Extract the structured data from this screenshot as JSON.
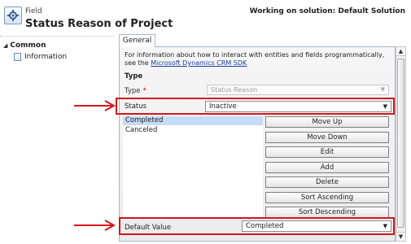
{
  "header": {
    "subtitle": "Field",
    "title": "Status Reason of Project",
    "solution": "Working on solution: Default Solution",
    "icon": "field-settings-icon"
  },
  "nav": {
    "group": "Common",
    "items": [
      {
        "label": "Information",
        "icon": "document-icon"
      }
    ]
  },
  "tabs": [
    {
      "label": "General"
    }
  ],
  "main": {
    "info_text": "For information about how to interact with entities and fields programmatically, see the",
    "info_link": "Microsoft Dynamics CRM SDK",
    "type_heading": "Type",
    "type_label": "Type",
    "type_required": "*",
    "type_value": "Status Reason",
    "status_label": "Status",
    "status_value": "Inactive",
    "reasons": [
      "Completed",
      "Canceled"
    ],
    "selected_reason": "Completed",
    "buttons": {
      "move_up": "Move Up",
      "move_down": "Move Down",
      "edit": "Edit",
      "add": "Add",
      "delete": "Delete",
      "sort_asc": "Sort Ascending",
      "sort_desc": "Sort Descending"
    },
    "default_label": "Default Value",
    "default_value": "Completed"
  },
  "colors": {
    "highlight": "#d0181e",
    "selection": "#c6dbf5",
    "link": "#1b3fa5"
  }
}
